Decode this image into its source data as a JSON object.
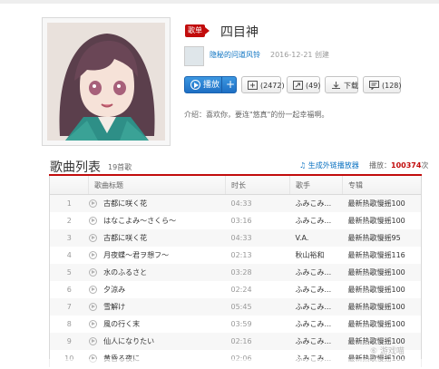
{
  "playlist": {
    "tag": "歌单",
    "title": "四目神",
    "creator": "隐秘的问道风铃",
    "created": "2016-12-21 创建",
    "intro": "介绍：喜欢你，要连\"悠真\"的份一起幸福啊。"
  },
  "actions": {
    "play_label": "播放",
    "plus_label": "+",
    "favorite_label": "(2472)",
    "share_label": "(49)",
    "download_label": "下载",
    "comment_label": "(128)"
  },
  "songlist": {
    "heading": "歌曲列表",
    "count": "19首歌",
    "outlink": "生成外链播放器",
    "playcount_label": "播放：",
    "playcount_value": "100374",
    "playcount_unit": "次"
  },
  "columns": [
    "歌曲标题",
    "时长",
    "歌手",
    "专辑"
  ],
  "rows": [
    {
      "n": "1",
      "title": "古都に咲く花",
      "dur": "04:33",
      "artist": "ふみこみ...",
      "album": "最新热歌慢摇100"
    },
    {
      "n": "2",
      "title": "はなこよみ～さくら～",
      "dur": "03:16",
      "artist": "ふみこみ...",
      "album": "最新热歌慢摇100"
    },
    {
      "n": "3",
      "title": "古都に咲く花",
      "dur": "04:33",
      "artist": "V.A.",
      "album": "最新热歌慢摇95"
    },
    {
      "n": "4",
      "title": "月夜蝶～君ヲ想フ～",
      "dur": "02:13",
      "artist": "秋山裕和",
      "album": "最新热歌慢摇116"
    },
    {
      "n": "5",
      "title": "水のふるさと",
      "dur": "03:28",
      "artist": "ふみこみ...",
      "album": "最新热歌慢摇100"
    },
    {
      "n": "6",
      "title": "夕涼み",
      "dur": "02:24",
      "artist": "ふみこみ...",
      "album": "最新热歌慢摇100"
    },
    {
      "n": "7",
      "title": "雪解け",
      "dur": "05:45",
      "artist": "ふみこみ...",
      "album": "最新热歌慢摇100"
    },
    {
      "n": "8",
      "title": "風の行く末",
      "dur": "03:59",
      "artist": "ふみこみ...",
      "album": "最新热歌慢摇100"
    },
    {
      "n": "9",
      "title": "仙人になりたい",
      "dur": "02:16",
      "artist": "ふみこみ...",
      "album": "最新热歌慢摇100"
    },
    {
      "n": "10",
      "title": "黄昏る夜に",
      "dur": "02:06",
      "artist": "ふみこみ...",
      "album": "最新热歌慢摇100"
    }
  ],
  "watermark": "⑥ 游戏喵",
  "colors": {
    "accent": "#c20c0c",
    "link": "#0c73c2",
    "play": "#1e6fc4"
  }
}
